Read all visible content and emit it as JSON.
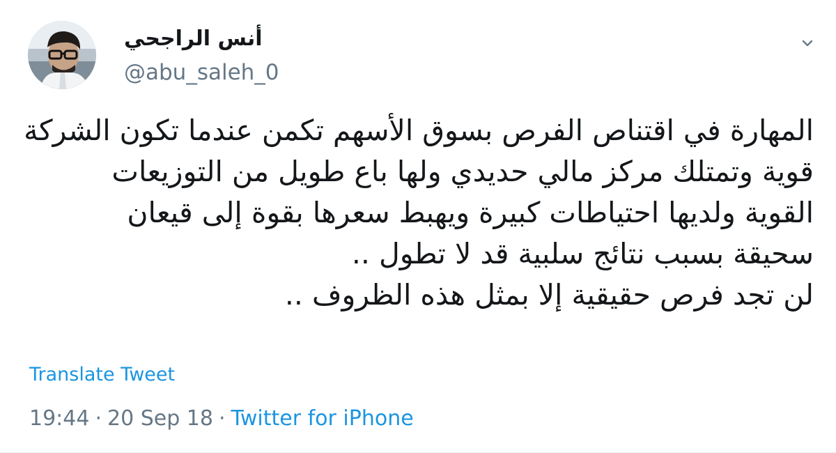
{
  "author": {
    "name": "أنس الراجحي",
    "handle": "@abu_saleh_0",
    "avatar_icon": "profile-photo"
  },
  "menu": {
    "caret_icon": "chevron-down-icon"
  },
  "tweet": {
    "lines": [
      "المهارة في اقتناص الفرص بسوق الأسهم تكمن عندما تكون الشركة",
      "قوية وتمتلك مركز مالي حديدي ولها باع طويل من التوزيعات",
      "القوية ولديها احتياطات كبيرة ويهبط سعرها بقوة إلى قيعان",
      "سحيقة بسبب نتائج سلبية قد لا تطول ..",
      "لن تجد فرص حقيقية إلا بمثل هذه الظروف .."
    ],
    "translate_label": "Translate Tweet",
    "time": "19:44",
    "separator": "·",
    "date": "20 Sep 18",
    "source": "Twitter for iPhone"
  },
  "colors": {
    "link": "#1b95e0",
    "secondary_text": "#657786",
    "primary_text": "#14171a"
  }
}
